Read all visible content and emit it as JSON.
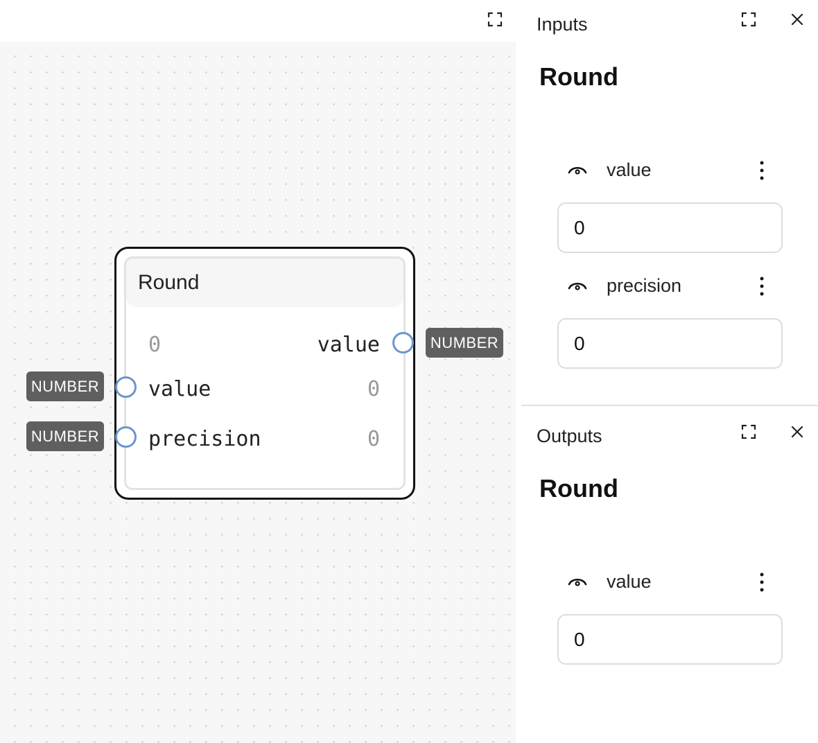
{
  "canvas": {
    "node": {
      "title": "Round",
      "output_rows": [
        {
          "label": "value",
          "value": "0",
          "type": "NUMBER"
        }
      ],
      "input_rows": [
        {
          "label": "value",
          "value": "0",
          "type": "NUMBER"
        },
        {
          "label": "precision",
          "value": "0",
          "type": "NUMBER"
        }
      ]
    }
  },
  "inputs_panel": {
    "title": "Inputs",
    "node_name": "Round",
    "fields": [
      {
        "name": "value",
        "value": "0"
      },
      {
        "name": "precision",
        "value": "0"
      }
    ]
  },
  "outputs_panel": {
    "title": "Outputs",
    "node_name": "Round",
    "fields": [
      {
        "name": "value",
        "value": "0"
      }
    ]
  },
  "colors": {
    "port_border": "#6b96d0",
    "type_tag_bg": "#5f5f5f",
    "canvas_bg": "#f7f7f7"
  },
  "icons": {
    "maximize": "maximize-icon",
    "close": "close-icon",
    "visibility": "eye-icon",
    "more": "kebab-icon"
  }
}
